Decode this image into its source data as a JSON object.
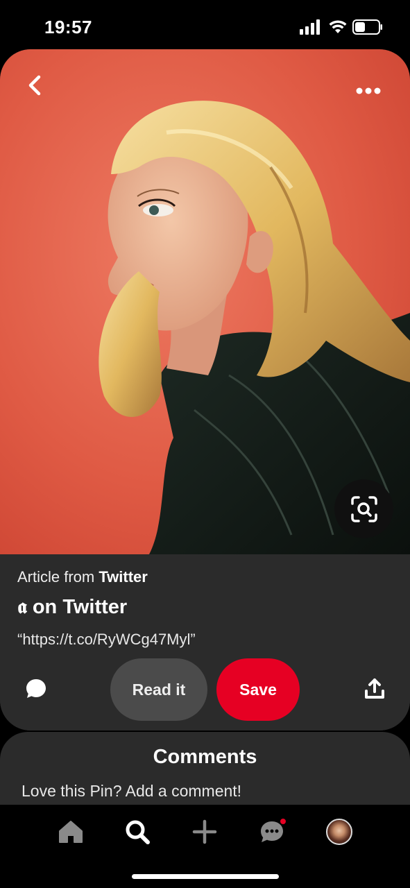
{
  "status_bar": {
    "time": "19:57"
  },
  "pin": {
    "source_prefix": "Article from",
    "source_name": "Twitter",
    "title": "𝖆 on Twitter",
    "description": "“https://t.co/RyWCg47Myl”",
    "read_label": "Read it",
    "save_label": "Save"
  },
  "comments": {
    "heading": "Comments",
    "placeholder": "Love this Pin? Add a comment!"
  },
  "nav": {
    "items": [
      "home",
      "search",
      "create",
      "messages",
      "profile"
    ],
    "messages_has_notification": true
  },
  "icons": {
    "back": "back-chevron-icon",
    "more": "more-dots-icon",
    "visual_search": "visual-search-icon",
    "comment": "comment-bubble-icon",
    "share": "share-icon"
  },
  "colors": {
    "accent": "#e60023",
    "background": "#000000",
    "card": "#2b2b2b",
    "secondary_button": "#4b4b4b"
  }
}
